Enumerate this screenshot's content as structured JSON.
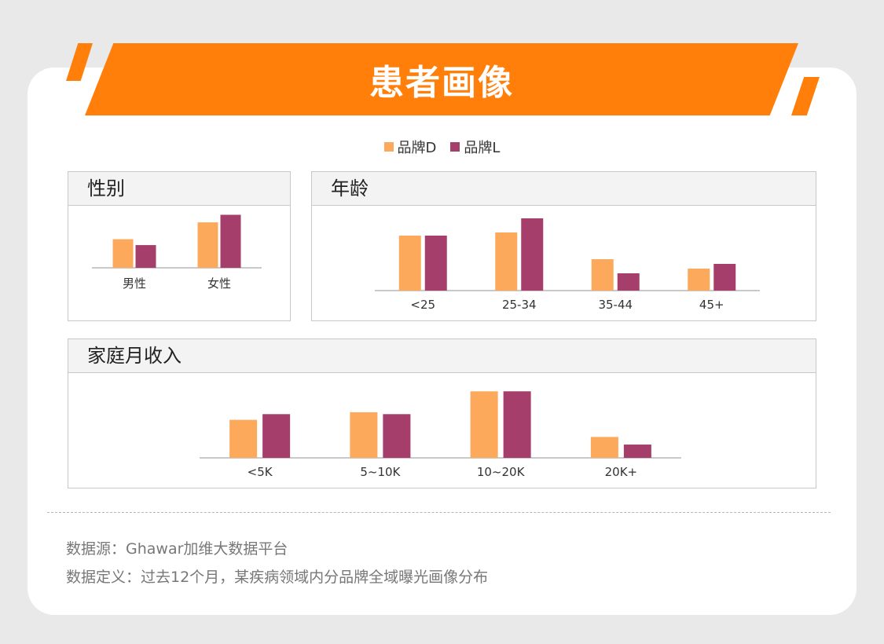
{
  "title": "患者画像",
  "legend": [
    {
      "label": "品牌D",
      "color": "#fda95b"
    },
    {
      "label": "品牌L",
      "color": "#a53e6a"
    }
  ],
  "chart_data": [
    {
      "type": "bar",
      "title": "性别",
      "categories": [
        "男性",
        "女性"
      ],
      "series": [
        {
          "name": "品牌D",
          "values": [
            34,
            54
          ]
        },
        {
          "name": "品牌L",
          "values": [
            27,
            63
          ]
        }
      ],
      "ylim": [
        0,
        70
      ]
    },
    {
      "type": "bar",
      "title": "年龄",
      "categories": [
        "<25",
        "25-34",
        "35-44",
        "45+"
      ],
      "series": [
        {
          "name": "品牌D",
          "values": [
            35,
            37,
            20,
            14
          ]
        },
        {
          "name": "品牌L",
          "values": [
            35,
            46,
            11,
            17
          ]
        }
      ],
      "ylim": [
        0,
        50
      ]
    },
    {
      "type": "bar",
      "title": "家庭月收入",
      "categories": [
        "<5K",
        "5~10K",
        "10~20K",
        "20K+"
      ],
      "series": [
        {
          "name": "品牌D",
          "values": [
            20,
            24,
            35,
            11
          ]
        },
        {
          "name": "品牌L",
          "values": [
            23,
            23,
            35,
            7
          ]
        }
      ],
      "ylim": [
        0,
        38
      ]
    }
  ],
  "footer": {
    "source": "数据源：Ghawar加维大数据平台",
    "definition": "数据定义：过去12个月，某疾病领域内分品牌全域曝光画像分布"
  }
}
